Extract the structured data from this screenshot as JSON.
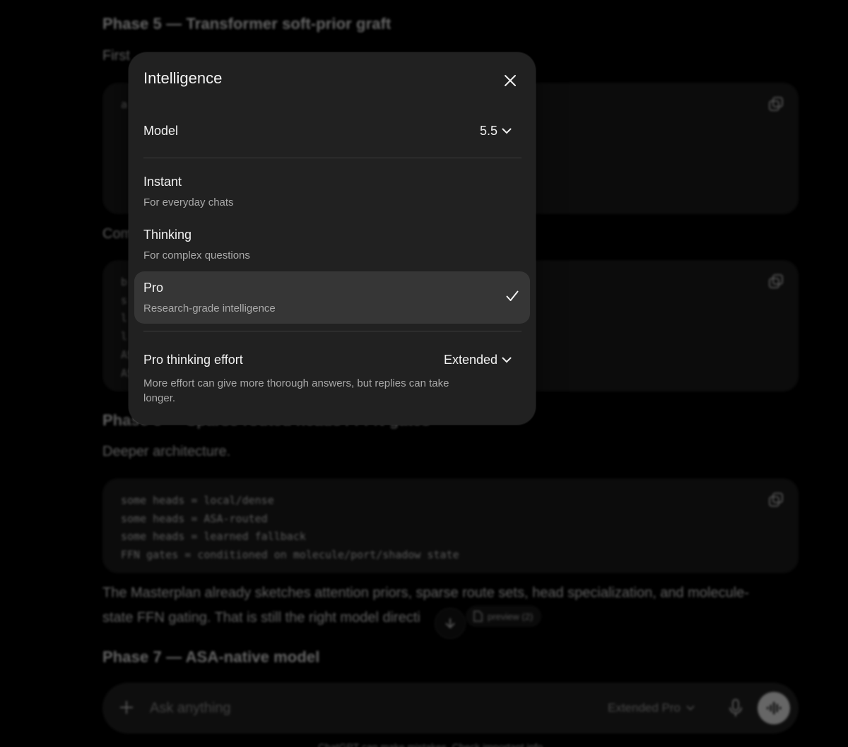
{
  "background": {
    "phase5_title": "Phase 5 — Transformer soft-prior graft",
    "phase5_intro": "First",
    "phase5_code": "a",
    "compare_intro": "Com",
    "block2_code_lines": [
      "b",
      "s",
      "l",
      "l",
      "AS",
      "AS"
    ],
    "phase6_title": "Phase 6 — Sparse routed heads / FFN gates",
    "phase6_intro": "Deeper architecture.",
    "phase6_code_lines": [
      "some heads = local/dense",
      "some heads = ASA-routed",
      "some heads = learned fallback",
      "FFN gates = conditioned on molecule/port/shadow state"
    ],
    "masterplan_line1": "The Masterplan already sketches attention priors, sparse route sets, head specialization, and molecule-",
    "masterplan_line2": "state FFN gating. That is still the right model directi",
    "preview_chip": "preview (2)",
    "phase7_title": "Phase 7 — ASA-native model",
    "composer": {
      "placeholder": "Ask anything",
      "mode_label": "Extended Pro"
    },
    "disclaimer": "ChatGPT can make mistakes. Check important info."
  },
  "modal": {
    "title": "Intelligence",
    "model_label": "Model",
    "model_value": "5.5",
    "options": [
      {
        "title": "Instant",
        "subtitle": "For everyday chats",
        "selected": false
      },
      {
        "title": "Thinking",
        "subtitle": "For complex questions",
        "selected": false
      },
      {
        "title": "Pro",
        "subtitle": "Research-grade intelligence",
        "selected": true
      }
    ],
    "effort_label": "Pro thinking effort",
    "effort_value": "Extended",
    "effort_description": "More effort can give more thorough answers, but replies can take longer."
  },
  "colors": {
    "modal_bg": "#212121",
    "selected_row_bg": "#363636",
    "page_bg": "#000000"
  }
}
